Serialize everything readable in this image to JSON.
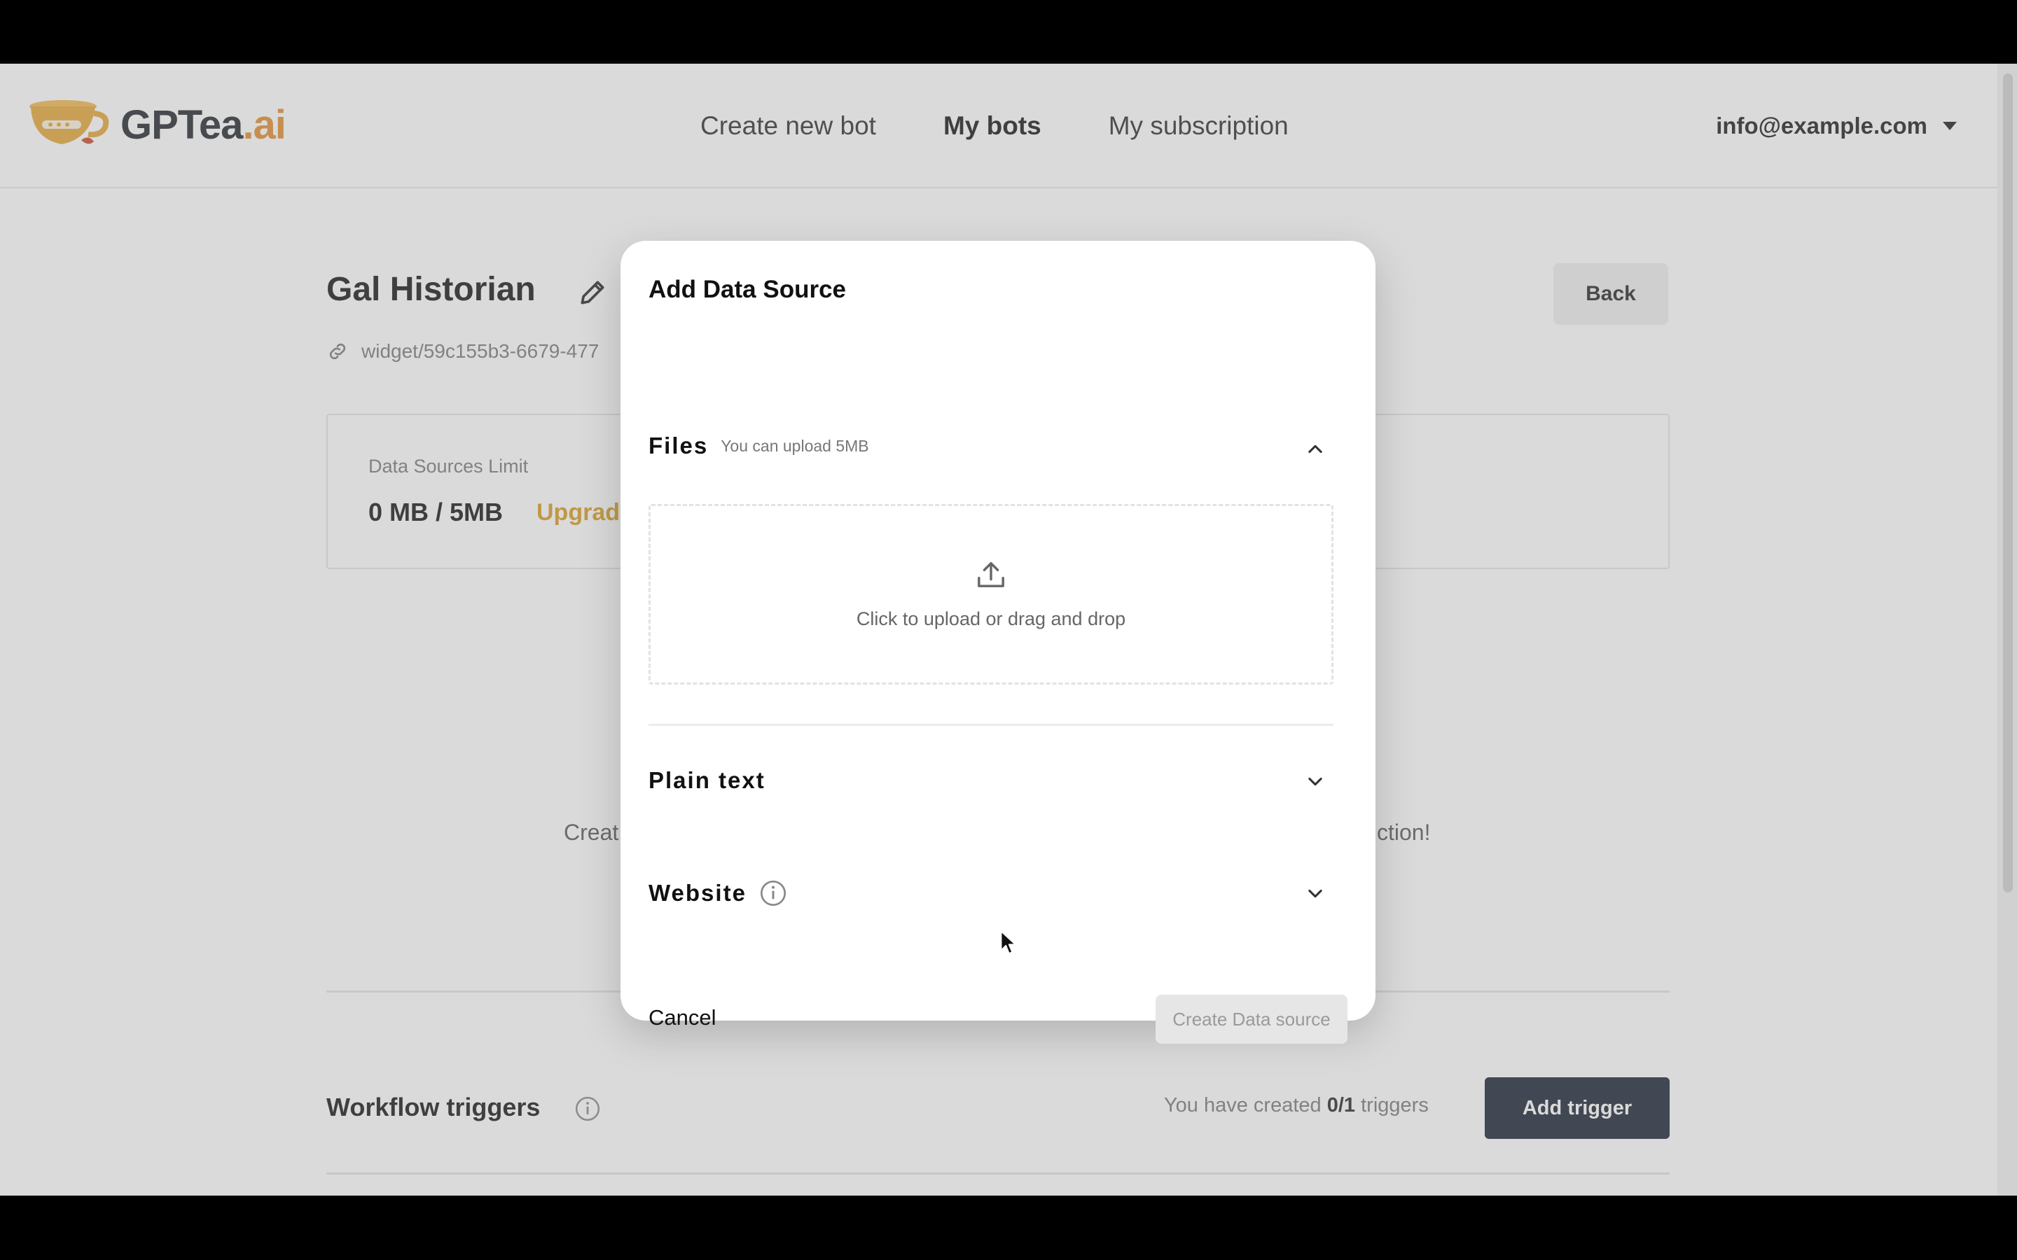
{
  "header": {
    "logo_text_main": "GPTea",
    "logo_text_suffix": ".ai",
    "nav": [
      {
        "label": "Create new bot",
        "active": false
      },
      {
        "label": "My bots",
        "active": true
      },
      {
        "label": "My subscription",
        "active": false
      }
    ],
    "account_email": "info@example.com"
  },
  "bot": {
    "title": "Gal Historian",
    "widget_link": "widget/59c155b3-6679-477",
    "back_label": "Back"
  },
  "limits": {
    "label": "Data Sources Limit",
    "value": "0 MB / 5MB",
    "upgrade_label": "Upgrad"
  },
  "empty_state": {
    "left_fragment": "Creat",
    "right_fragment": "ction!"
  },
  "workflow": {
    "title": "Workflow triggers",
    "count_prefix": "You have created ",
    "count_value": "0/1",
    "count_suffix": " triggers",
    "add_label": "Add trigger"
  },
  "modal": {
    "title": "Add Data Source",
    "files": {
      "title": "Files",
      "subtitle": "You can upload 5MB",
      "dropzone_text": "Click to upload or drag and drop"
    },
    "plain_text": {
      "title": "Plain text"
    },
    "website": {
      "title": "Website"
    },
    "cancel_label": "Cancel",
    "create_label": "Create Data source"
  },
  "colors": {
    "accent_orange": "#e08a2a",
    "upgrade_gold": "#d89a1d",
    "dark_button": "#142030"
  }
}
